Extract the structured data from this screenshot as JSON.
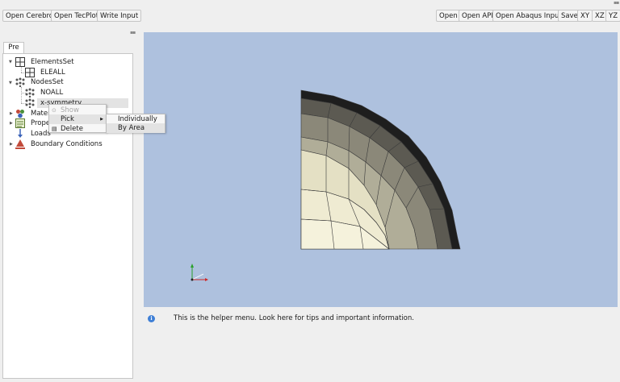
{
  "toolbar": {
    "left_buttons": [
      "Open Cerebro",
      "Open TecPlot",
      "Write Input"
    ],
    "right_buttons": [
      "Open",
      "Open API",
      "Open Abaqus Input",
      "Save",
      "XY",
      "XZ",
      "YZ"
    ]
  },
  "tabs": {
    "pre": "Pre"
  },
  "tree": {
    "elements_set": "ElementsSet",
    "eleall": "ELEALL",
    "nodes_set": "NodesSet",
    "noall": "NOALL",
    "xsym": "x-symmetry",
    "materials": "Mater",
    "properties": "Prope",
    "loads": "Loads",
    "bcs": "Boundary Conditions"
  },
  "context_menu": {
    "show": "Show",
    "pick": "Pick",
    "delete": "Delete"
  },
  "submenu": {
    "individually": "Individually",
    "by_area": "By Area"
  },
  "helper": {
    "info_glyph": "i",
    "text": "This is the helper menu. Look here for tips and important information."
  },
  "colors": {
    "viewport_bg": "#aec1de",
    "mesh_edge": "#3a3a3a",
    "highlight": "#e3e3e3"
  },
  "icons": {
    "elements": "grid-icon",
    "nodes": "dots-icon",
    "materials": "materials-icon",
    "properties": "properties-icon",
    "loads": "loads-icon",
    "bcs": "boundary-icon"
  }
}
